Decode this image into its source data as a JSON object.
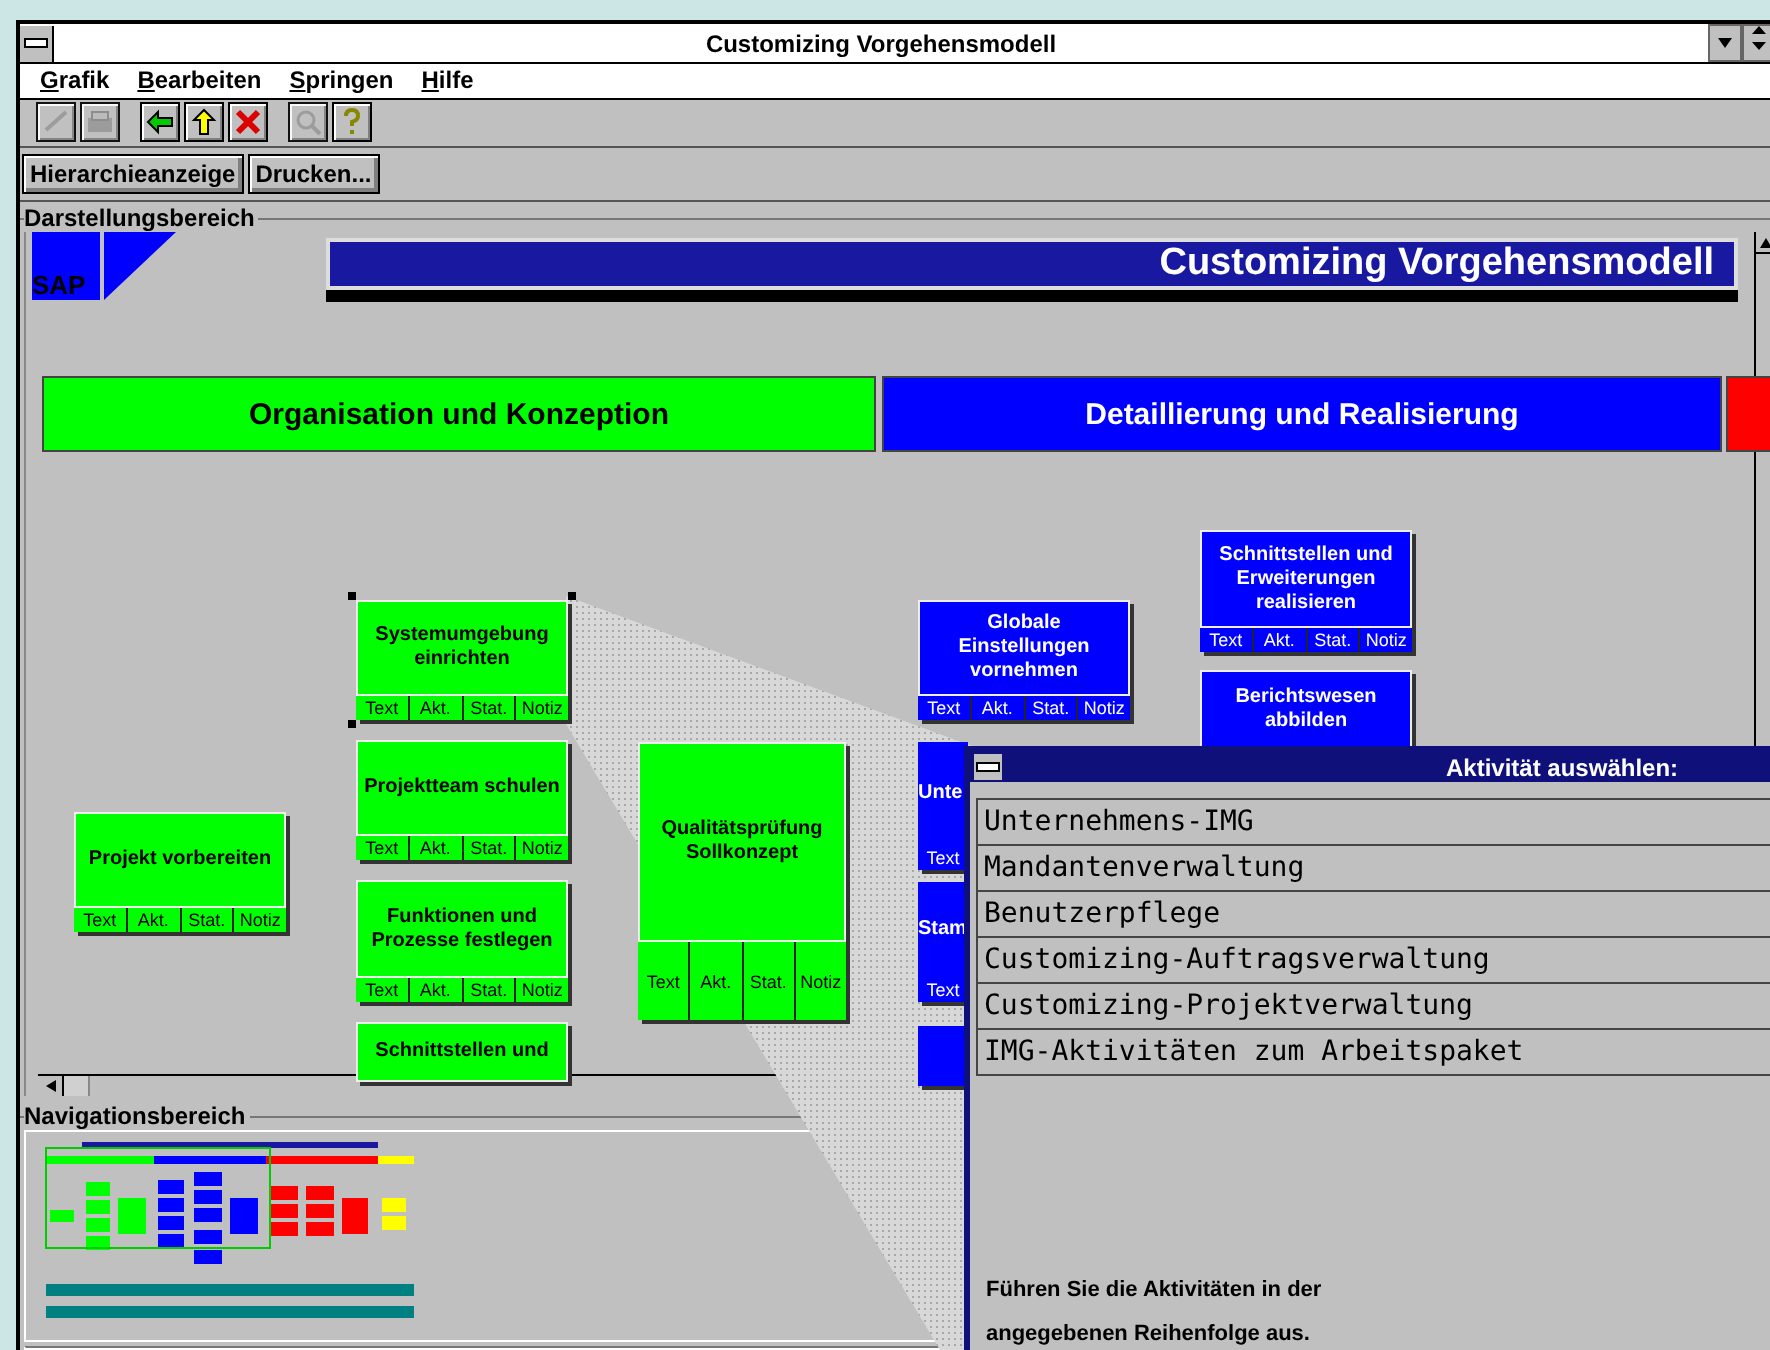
{
  "window": {
    "title": "Customizing Vorgehensmodell"
  },
  "menu": [
    "Grafik",
    "Bearbeiten",
    "Springen",
    "Hilfe"
  ],
  "toolbar": [
    {
      "kind": "check",
      "disabled": true
    },
    {
      "kind": "print",
      "disabled": true
    },
    {
      "kind": "back",
      "disabled": false
    },
    {
      "kind": "up",
      "disabled": false
    },
    {
      "kind": "cancel",
      "disabled": false
    },
    {
      "kind": "find",
      "disabled": true
    },
    {
      "kind": "help",
      "disabled": false
    }
  ],
  "buttons": [
    "Hierarchieanzeige",
    "Drucken..."
  ],
  "display_area": {
    "label": "Darstellungsbereich",
    "logo": "SAP",
    "banner": "Customizing Vorgehensmodell",
    "phases": [
      {
        "title": "Organisation und Konzeption",
        "color": "#00ff00"
      },
      {
        "title": "Detaillierung und Realisierung",
        "color": "#0000ff"
      },
      {
        "color": "#ff0000"
      }
    ],
    "nodes": [
      {
        "title": "Projekt vorbereiten",
        "color": "#00ff00",
        "selected": false,
        "buttons": [
          "Text",
          "Akt.",
          "Stat.",
          "Notiz"
        ]
      },
      {
        "title": "Systemumgebung einrichten",
        "color": "#00ff00",
        "selected": true,
        "buttons": [
          "Text",
          "Akt.",
          "Stat.",
          "Notiz"
        ]
      },
      {
        "title": "Projektteam schulen",
        "color": "#00ff00",
        "selected": false,
        "buttons": [
          "Text",
          "Akt.",
          "Stat.",
          "Notiz"
        ]
      },
      {
        "title": "Funktionen und Prozesse festlegen",
        "color": "#00ff00",
        "selected": false,
        "buttons": [
          "Text",
          "Akt.",
          "Stat.",
          "Notiz"
        ]
      },
      {
        "title": "Schnittstellen und",
        "color": "#00ff00",
        "selected": false
      },
      {
        "title": "Qualitätsprüfung Sollkonzept",
        "color": "#00ff00",
        "selected": false,
        "buttons": [
          "Text",
          "Akt.",
          "Stat.",
          "Notiz"
        ]
      },
      {
        "title": "Globale Einstellungen vornehmen",
        "color": "#0000ff",
        "selected": false,
        "buttons": [
          "Text",
          "Akt.",
          "Stat.",
          "Notiz"
        ]
      },
      {
        "title": "Unte",
        "color": "#0000ff",
        "selected": false,
        "buttons": [
          "Text"
        ]
      },
      {
        "title": "Stam",
        "color": "#0000ff",
        "selected": false,
        "buttons": [
          "Text"
        ]
      },
      {
        "color": "#0000ff",
        "selected": false
      },
      {
        "title": "Schnittstellen und Erweiterungen realisieren",
        "color": "#0000ff",
        "selected": false,
        "buttons": [
          "Text",
          "Akt.",
          "Stat.",
          "Notiz"
        ]
      },
      {
        "title": "Berichtswesen abbilden",
        "color": "#0000ff",
        "selected": false
      }
    ]
  },
  "navigation_area": {
    "label": "Navigationsbereich"
  },
  "dialog": {
    "title": "Aktivität auswählen:",
    "items": [
      "Unternehmens-IMG",
      "Mandantenverwaltung",
      "Benutzerpflege",
      "Customizing-Auftragsverwaltung",
      "Customizing-Projektverwaltung",
      "IMG-Aktivitäten zum Arbeitspaket"
    ],
    "hint": "Führen Sie die Aktivitäten in der angegebenen Reihenfolge aus."
  }
}
